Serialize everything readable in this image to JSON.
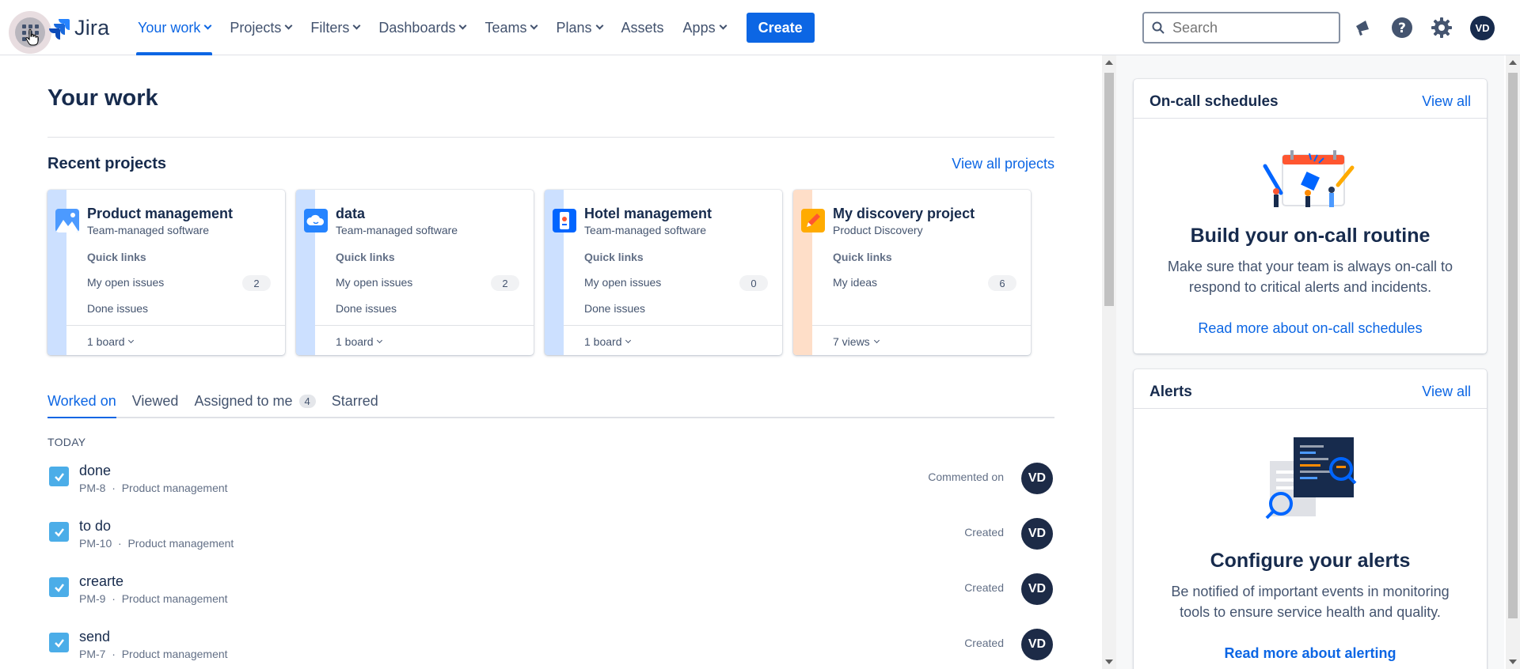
{
  "app": {
    "name": "Jira"
  },
  "nav": {
    "items": [
      {
        "label": "Your work",
        "dropdown": true,
        "active": true
      },
      {
        "label": "Projects",
        "dropdown": true
      },
      {
        "label": "Filters",
        "dropdown": true
      },
      {
        "label": "Dashboards",
        "dropdown": true
      },
      {
        "label": "Teams",
        "dropdown": true
      },
      {
        "label": "Plans",
        "dropdown": true
      },
      {
        "label": "Assets",
        "dropdown": false
      },
      {
        "label": "Apps",
        "dropdown": true
      }
    ],
    "create_label": "Create",
    "search_placeholder": "Search",
    "avatar_initials": "VD"
  },
  "main": {
    "title": "Your work",
    "recent_projects_title": "Recent projects",
    "view_all_projects": "View all projects",
    "projects": [
      {
        "name": "Product management",
        "type": "Team-managed software",
        "quick_links": "Quick links",
        "link1": "My open issues",
        "count": "2",
        "link2": "Done issues",
        "footer": "1 board",
        "stripe_color": "#cce0ff",
        "icon": "mountain-icon"
      },
      {
        "name": "data",
        "type": "Team-managed software",
        "quick_links": "Quick links",
        "link1": "My open issues",
        "count": "2",
        "link2": "Done issues",
        "footer": "1 board",
        "stripe_color": "#cce0ff",
        "icon": "cloud-icon"
      },
      {
        "name": "Hotel management",
        "type": "Team-managed software",
        "quick_links": "Quick links",
        "link1": "My open issues",
        "count": "0",
        "link2": "Done issues",
        "footer": "1 board",
        "stripe_color": "#cce0ff",
        "icon": "phone-icon"
      },
      {
        "name": "My discovery project",
        "type": "Product Discovery",
        "quick_links": "Quick links",
        "link1": "My ideas",
        "count": "6",
        "link2": "",
        "footer": "7 views",
        "stripe_color": "#fedec8",
        "icon": "pencil-icon"
      }
    ],
    "tabs": [
      {
        "label": "Worked on",
        "active": true
      },
      {
        "label": "Viewed"
      },
      {
        "label": "Assigned to me",
        "badge": "4"
      },
      {
        "label": "Starred"
      }
    ],
    "today_label": "TODAY",
    "issues": [
      {
        "title": "done",
        "key": "PM-8",
        "project": "Product management",
        "action": "Commented on",
        "avatar": "VD"
      },
      {
        "title": "to do",
        "key": "PM-10",
        "project": "Product management",
        "action": "Created",
        "avatar": "VD"
      },
      {
        "title": "crearte",
        "key": "PM-9",
        "project": "Product management",
        "action": "Created",
        "avatar": "VD"
      },
      {
        "title": "send",
        "key": "PM-7",
        "project": "Product management",
        "action": "Created",
        "avatar": "VD"
      }
    ]
  },
  "right": {
    "oncall": {
      "title": "On-call schedules",
      "view_all": "View all",
      "heading": "Build your on-call routine",
      "text": "Make sure that your team is always on-call to respond to critical alerts and incidents.",
      "link": "Read more about on-call schedules"
    },
    "alerts": {
      "title": "Alerts",
      "view_all": "View all",
      "heading": "Configure your alerts",
      "text": "Be notified of important events in monitoring tools to ensure service health and quality.",
      "link": "Read more about alerting"
    }
  },
  "colors": {
    "accent": "#0c66e4",
    "text": "#172b4d",
    "issue_checkbox": "#4bade8"
  }
}
